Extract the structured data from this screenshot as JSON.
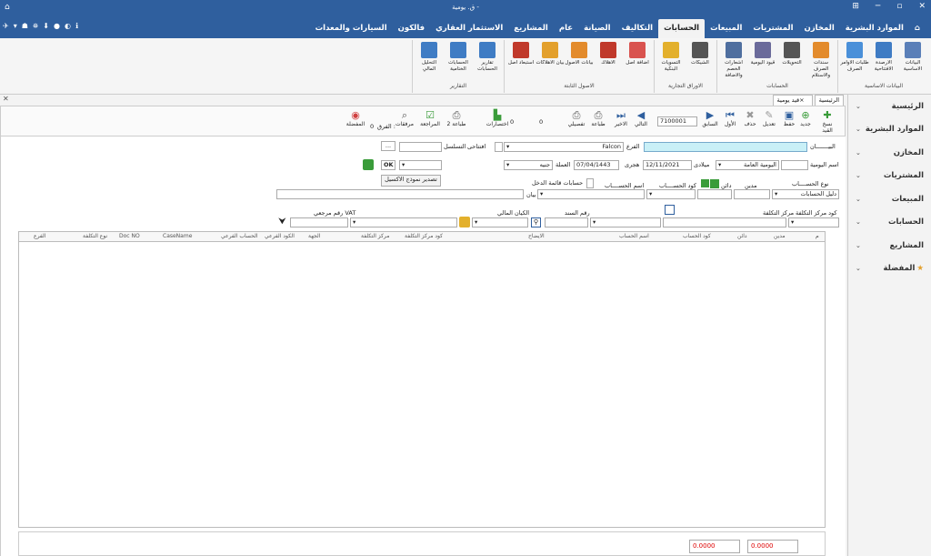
{
  "window": {
    "title": "ق. يومية -",
    "btn_min": "─",
    "btn_max": "▫",
    "btn_close": "✕",
    "btn_extra": "⊞"
  },
  "qat_icons": [
    "✈",
    "▾",
    "☗",
    "⛯",
    "⬇",
    "●",
    "◐",
    "ℹ"
  ],
  "menu": {
    "home_icon": "⌂",
    "tabs": [
      "الموارد البشرية",
      "المخازن",
      "المشتريات",
      "المبيعات",
      "الحسابات",
      "التكاليف",
      "الصيانة",
      "عام",
      "المشاريع",
      "الاستثمار العقاري",
      "فالكون",
      "السيارات والمعدات"
    ],
    "active_tab": "الحسابات"
  },
  "ribbon": {
    "groups": [
      {
        "label": "البيانات الاساسية",
        "buttons": [
          {
            "label": "البيانات الاساسية",
            "color": "#5a7fb8"
          },
          {
            "label": "الارصدة الافتتاحية",
            "color": "#3f7cc4"
          },
          {
            "label": "طلبات الاوامر الصرف",
            "color": "#4a90d9"
          }
        ]
      },
      {
        "label": "الحسابات",
        "buttons": [
          {
            "label": "سندات الصرف والاستلام",
            "color": "#e38b2c"
          },
          {
            "label": "التحويلات",
            "color": "#555555"
          },
          {
            "label": "قيود اليومية",
            "color": "#6a6a9a"
          },
          {
            "label": "اشعارات الخصم والاضافة",
            "color": "#4f6f9f"
          }
        ]
      },
      {
        "label": "الاوراق التجارية",
        "buttons": [
          {
            "label": "الشيكات",
            "color": "#555555"
          },
          {
            "label": "التسويات البنكية",
            "color": "#e3b02c"
          }
        ]
      },
      {
        "label": "الاصول الثابتة",
        "buttons": [
          {
            "label": "اضافة اصل",
            "color": "#d9534f"
          },
          {
            "label": "الاهلاك",
            "color": "#c0392b"
          },
          {
            "label": "بيانات الاصول",
            "color": "#e38b2c"
          },
          {
            "label": "بيان الاهلاكات",
            "color": "#e3a02c"
          },
          {
            "label": "استبعاد اصل",
            "color": "#c0392b"
          }
        ]
      },
      {
        "label": "التقارير",
        "buttons": [
          {
            "label": "تقارير الحسابات",
            "color": "#3f7cc4"
          },
          {
            "label": "الحسابات الختامية",
            "color": "#3f7cc4"
          },
          {
            "label": "التحليل المالي",
            "color": "#3f7cc4"
          }
        ]
      }
    ]
  },
  "close_x": "✕",
  "collapse_icon": "⌃",
  "sidebar": {
    "items": [
      {
        "label": "الرئيسية",
        "icon": ""
      },
      {
        "label": "الموارد البشرية",
        "icon": ""
      },
      {
        "label": "المخازن",
        "icon": ""
      },
      {
        "label": "المشتريات",
        "icon": ""
      },
      {
        "label": "المبيعات",
        "icon": ""
      },
      {
        "label": "الحسابات",
        "icon": ""
      },
      {
        "label": "المشاريع",
        "icon": ""
      },
      {
        "label": "المفضلة",
        "icon": "★"
      }
    ],
    "chevron": "⌄"
  },
  "doc_tabs": [
    {
      "label": "الرئيسية"
    },
    {
      "label": "قيد يومية"
    }
  ],
  "doc_tab_close": "×",
  "toolbar": {
    "new": "جديد",
    "copy": "نسخ القيد",
    "save": "حفظ",
    "edit": "تعديل",
    "delete": "حذف",
    "first": "الأول",
    "prev": "السابق",
    "record_no": "7100001",
    "next": "التالي",
    "last": "الاخير",
    "print_detail": "تفصيلي",
    "print": "طباعة",
    "counter": "0",
    "shortcuts": "اختصارات",
    "print2": "طباعة 2",
    "review": "المراجعة",
    "attachments": "مرفقات",
    "favorites": "المفضلة",
    "diff_label": "الفرق :",
    "diff_value": "0",
    "count_value": "0"
  },
  "form": {
    "statement_label": "البيـــــــان",
    "branch_label": "الفرع",
    "branch_value": "Falcon",
    "closing_label": "افتتاحى",
    "sequence_label": "التسلسل",
    "sequence_btn": "...",
    "journal_name_label": "اسم اليومية",
    "journal_name_value": "اليومية العامة",
    "gregorian_label": "ميلادى",
    "gregorian_value": "12/11/2021",
    "hijri_label": "هجرى",
    "hijri_value": "07/04/1443",
    "currency_label": "العملة",
    "currency_value": "جنيه",
    "ok": "OK",
    "income_accounts_label": "حسابات قائمة الدخل",
    "export_template": "تصدير نموذج الاكسيل",
    "account_type_label": "نوع الحســــاب",
    "account_type_value": "دليل الحسابات",
    "debit_label": "مدين",
    "credit_label": "دائن",
    "account_code_label": "كود الحســــاب",
    "account_name_label": "اسم الحســــاب",
    "desc_label": "بيان",
    "cost_center_code_label": "كود مركز التكلفة",
    "cost_center_label": "مركز التكلفة",
    "doc_no_label": "رقم السند",
    "finance_entity_label": "الكيان المالي",
    "vat_ref_label": "رقم مرجعي VAT"
  },
  "grid": {
    "columns": [
      "م",
      "مدين",
      "دائن",
      "كود الحساب",
      "اسم الحساب",
      "الايضاح",
      "كود مركز التكلفة",
      "مركز التكلفة",
      "الجهة",
      "الكود الفرعي",
      "الحساب الفرعي",
      "CaseName",
      "Doc NO",
      "نوع التكلفة",
      "الفرع"
    ]
  },
  "totals": {
    "debit": "0.0000",
    "credit": "0.0000"
  },
  "colors": {
    "titlebar": "#2f5f9e",
    "statement_bg": "#c9f0f7",
    "totals_text": "#dd0000"
  }
}
